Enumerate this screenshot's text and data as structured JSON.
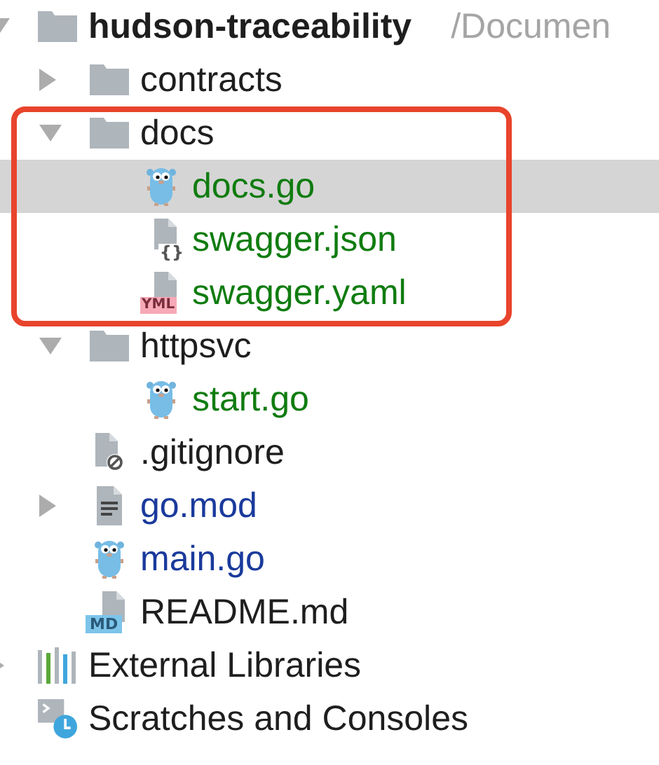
{
  "tree": [
    {
      "kind": "folder",
      "label": "hudson-traceability",
      "path": "/Documen",
      "expanded": true,
      "selected": false,
      "color": "#1e1e1e",
      "children": [
        {
          "kind": "folder",
          "label": "contracts",
          "expanded": false,
          "selected": false,
          "color": "#1e1e1e"
        },
        {
          "kind": "folder",
          "label": "docs",
          "expanded": true,
          "selected": false,
          "color": "#1e1e1e",
          "highlighted": true,
          "children": [
            {
              "kind": "go",
              "label": "docs.go",
              "selected": true,
              "color": "#107c10"
            },
            {
              "kind": "json",
              "badge": "{}",
              "label": "swagger.json",
              "selected": false,
              "color": "#107c10"
            },
            {
              "kind": "yaml",
              "badge": "YML",
              "label": "swagger.yaml",
              "selected": false,
              "color": "#107c10"
            }
          ]
        },
        {
          "kind": "folder",
          "label": "httpsvc",
          "expanded": true,
          "selected": false,
          "color": "#1e1e1e",
          "children": [
            {
              "kind": "go",
              "label": "start.go",
              "selected": false,
              "color": "#107c10"
            }
          ]
        },
        {
          "kind": "ignore",
          "label": ".gitignore",
          "selected": false,
          "color": "#1e1e1e"
        },
        {
          "kind": "text",
          "label": "go.mod",
          "expanded": false,
          "selected": false,
          "color": "#1a3a9c"
        },
        {
          "kind": "go",
          "label": "main.go",
          "selected": false,
          "color": "#1a3a9c"
        },
        {
          "kind": "markdown",
          "badge": "MD",
          "label": "README.md",
          "selected": false,
          "color": "#1e1e1e"
        }
      ]
    },
    {
      "kind": "libraries",
      "label": "External Libraries",
      "expanded": false,
      "selected": false,
      "color": "#1e1e1e"
    },
    {
      "kind": "scratches",
      "label": "Scratches and Consoles",
      "selected": false,
      "color": "#1e1e1e"
    }
  ]
}
